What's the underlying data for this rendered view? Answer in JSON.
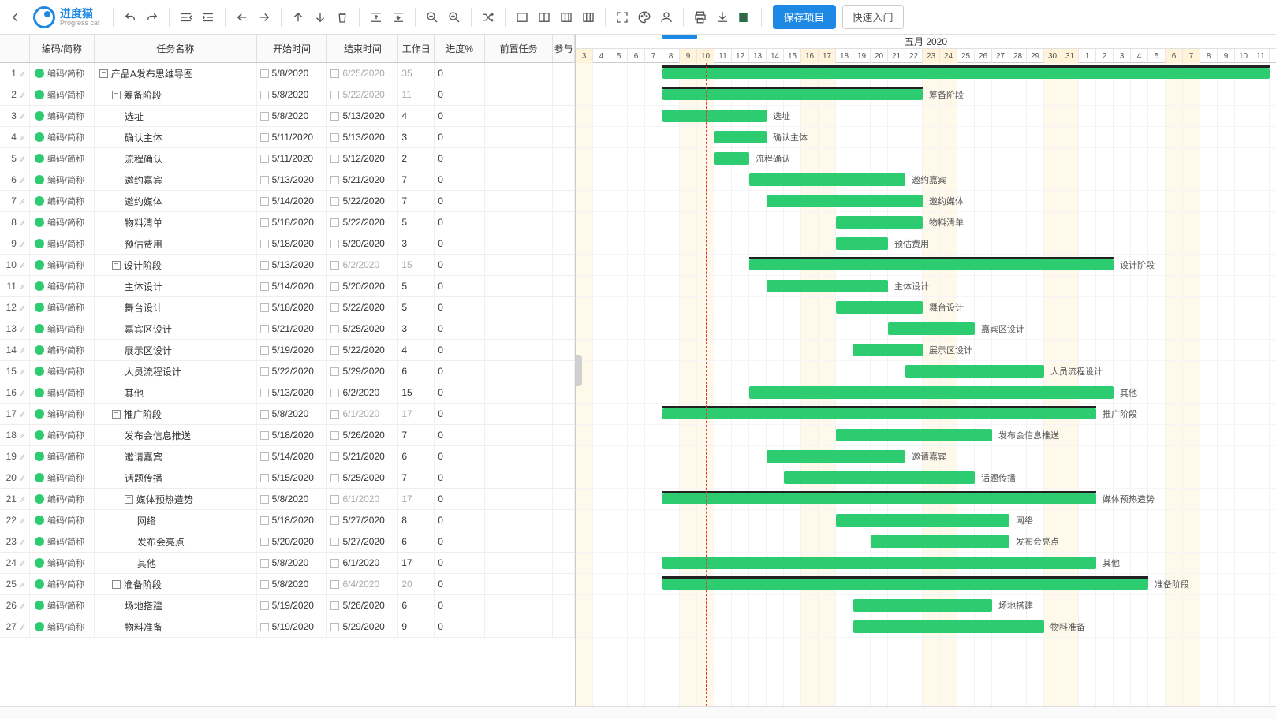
{
  "app": {
    "name": "进度猫",
    "sub": "Progress cat"
  },
  "toolbar": {
    "save": "保存项目",
    "quick": "快速入门"
  },
  "columns": {
    "idx": "",
    "code": "编码/简称",
    "name": "任务名称",
    "start": "开始时间",
    "end": "结束时间",
    "work": "工作日",
    "prog": "进度%",
    "pre": "前置任务",
    "part": "参与"
  },
  "timeline": {
    "month": "五月 2020",
    "days": [
      {
        "d": "3",
        "w": true
      },
      {
        "d": "4"
      },
      {
        "d": "5"
      },
      {
        "d": "6"
      },
      {
        "d": "7"
      },
      {
        "d": "8"
      },
      {
        "d": "9",
        "w": true
      },
      {
        "d": "10",
        "w": true
      },
      {
        "d": "11"
      },
      {
        "d": "12"
      },
      {
        "d": "13"
      },
      {
        "d": "14"
      },
      {
        "d": "15"
      },
      {
        "d": "16",
        "w": true
      },
      {
        "d": "17",
        "w": true
      },
      {
        "d": "18"
      },
      {
        "d": "19"
      },
      {
        "d": "20"
      },
      {
        "d": "21"
      },
      {
        "d": "22"
      },
      {
        "d": "23",
        "w": true
      },
      {
        "d": "24",
        "w": true
      },
      {
        "d": "25"
      },
      {
        "d": "26"
      },
      {
        "d": "27"
      },
      {
        "d": "28"
      },
      {
        "d": "29"
      },
      {
        "d": "30",
        "w": true
      },
      {
        "d": "31",
        "w": true
      },
      {
        "d": "1"
      },
      {
        "d": "2"
      },
      {
        "d": "3"
      },
      {
        "d": "4"
      },
      {
        "d": "5"
      },
      {
        "d": "6",
        "w": true
      },
      {
        "d": "7",
        "w": true
      },
      {
        "d": "8"
      },
      {
        "d": "9"
      },
      {
        "d": "10"
      },
      {
        "d": "11"
      }
    ],
    "todayIndex": 7,
    "markerStart": 5,
    "markerSpan": 2
  },
  "tasks": [
    {
      "id": 1,
      "code": "编码/简称",
      "name": "产品A发布思维导图",
      "indent": 0,
      "group": true,
      "start": "5/8/2020",
      "end": "6/25/2020",
      "endDim": true,
      "work": "35",
      "workDim": true,
      "prog": "0",
      "s": 5,
      "e": 40
    },
    {
      "id": 2,
      "code": "编码/简称",
      "name": "筹备阶段",
      "indent": 1,
      "group": true,
      "start": "5/8/2020",
      "end": "5/22/2020",
      "endDim": true,
      "work": "11",
      "workDim": true,
      "prog": "0",
      "s": 5,
      "e": 20,
      "label": "筹备阶段"
    },
    {
      "id": 3,
      "code": "编码/简称",
      "name": "选址",
      "indent": 2,
      "start": "5/8/2020",
      "end": "5/13/2020",
      "work": "4",
      "prog": "0",
      "s": 5,
      "e": 11,
      "label": "选址"
    },
    {
      "id": 4,
      "code": "编码/简称",
      "name": "确认主体",
      "indent": 2,
      "start": "5/11/2020",
      "end": "5/13/2020",
      "work": "3",
      "prog": "0",
      "s": 8,
      "e": 11,
      "label": "确认主体"
    },
    {
      "id": 5,
      "code": "编码/简称",
      "name": "流程确认",
      "indent": 2,
      "start": "5/11/2020",
      "end": "5/12/2020",
      "work": "2",
      "prog": "0",
      "s": 8,
      "e": 10,
      "label": "流程确认"
    },
    {
      "id": 6,
      "code": "编码/简称",
      "name": "邀约嘉宾",
      "indent": 2,
      "start": "5/13/2020",
      "end": "5/21/2020",
      "work": "7",
      "prog": "0",
      "s": 10,
      "e": 19,
      "label": "邀约嘉宾"
    },
    {
      "id": 7,
      "code": "编码/简称",
      "name": "邀约媒体",
      "indent": 2,
      "start": "5/14/2020",
      "end": "5/22/2020",
      "work": "7",
      "prog": "0",
      "s": 11,
      "e": 20,
      "label": "邀约媒体"
    },
    {
      "id": 8,
      "code": "编码/简称",
      "name": "物料清单",
      "indent": 2,
      "start": "5/18/2020",
      "end": "5/22/2020",
      "work": "5",
      "prog": "0",
      "s": 15,
      "e": 20,
      "label": "物料清单"
    },
    {
      "id": 9,
      "code": "编码/简称",
      "name": "预估费用",
      "indent": 2,
      "start": "5/18/2020",
      "end": "5/20/2020",
      "work": "3",
      "prog": "0",
      "s": 15,
      "e": 18,
      "label": "预估费用"
    },
    {
      "id": 10,
      "code": "编码/简称",
      "name": "设计阶段",
      "indent": 1,
      "group": true,
      "start": "5/13/2020",
      "end": "6/2/2020",
      "endDim": true,
      "work": "15",
      "workDim": true,
      "prog": "0",
      "s": 10,
      "e": 31,
      "label": "设计阶段"
    },
    {
      "id": 11,
      "code": "编码/简称",
      "name": "主体设计",
      "indent": 2,
      "start": "5/14/2020",
      "end": "5/20/2020",
      "work": "5",
      "prog": "0",
      "s": 11,
      "e": 18,
      "label": "主体设计"
    },
    {
      "id": 12,
      "code": "编码/简称",
      "name": "舞台设计",
      "indent": 2,
      "start": "5/18/2020",
      "end": "5/22/2020",
      "work": "5",
      "prog": "0",
      "s": 15,
      "e": 20,
      "label": "舞台设计"
    },
    {
      "id": 13,
      "code": "编码/简称",
      "name": "嘉宾区设计",
      "indent": 2,
      "start": "5/21/2020",
      "end": "5/25/2020",
      "work": "3",
      "prog": "0",
      "s": 18,
      "e": 23,
      "label": "嘉宾区设计"
    },
    {
      "id": 14,
      "code": "编码/简称",
      "name": "展示区设计",
      "indent": 2,
      "start": "5/19/2020",
      "end": "5/22/2020",
      "work": "4",
      "prog": "0",
      "s": 16,
      "e": 20,
      "label": "展示区设计"
    },
    {
      "id": 15,
      "code": "编码/简称",
      "name": "人员流程设计",
      "indent": 2,
      "start": "5/22/2020",
      "end": "5/29/2020",
      "work": "6",
      "prog": "0",
      "s": 19,
      "e": 27,
      "label": "人员流程设计"
    },
    {
      "id": 16,
      "code": "编码/简称",
      "name": "其他",
      "indent": 2,
      "start": "5/13/2020",
      "end": "6/2/2020",
      "work": "15",
      "prog": "0",
      "s": 10,
      "e": 31,
      "label": "其他"
    },
    {
      "id": 17,
      "code": "编码/简称",
      "name": "推广阶段",
      "indent": 1,
      "group": true,
      "start": "5/8/2020",
      "end": "6/1/2020",
      "endDim": true,
      "work": "17",
      "workDim": true,
      "prog": "0",
      "s": 5,
      "e": 30,
      "label": "推广阶段"
    },
    {
      "id": 18,
      "code": "编码/简称",
      "name": "发布会信息推送",
      "indent": 2,
      "start": "5/18/2020",
      "end": "5/26/2020",
      "work": "7",
      "prog": "0",
      "s": 15,
      "e": 24,
      "label": "发布会信息推送"
    },
    {
      "id": 19,
      "code": "编码/简称",
      "name": "邀请嘉宾",
      "indent": 2,
      "start": "5/14/2020",
      "end": "5/21/2020",
      "work": "6",
      "prog": "0",
      "s": 11,
      "e": 19,
      "label": "邀请嘉宾"
    },
    {
      "id": 20,
      "code": "编码/简称",
      "name": "话题传播",
      "indent": 2,
      "start": "5/15/2020",
      "end": "5/25/2020",
      "work": "7",
      "prog": "0",
      "s": 12,
      "e": 23,
      "label": "话题传播"
    },
    {
      "id": 21,
      "code": "编码/简称",
      "name": "媒体预热造势",
      "indent": 2,
      "group": true,
      "start": "5/8/2020",
      "end": "6/1/2020",
      "endDim": true,
      "work": "17",
      "workDim": true,
      "prog": "0",
      "s": 5,
      "e": 30,
      "label": "媒体预热造势"
    },
    {
      "id": 22,
      "code": "编码/简称",
      "name": "网络",
      "indent": 3,
      "start": "5/18/2020",
      "end": "5/27/2020",
      "work": "8",
      "prog": "0",
      "s": 15,
      "e": 25,
      "label": "网络"
    },
    {
      "id": 23,
      "code": "编码/简称",
      "name": "发布会亮点",
      "indent": 3,
      "start": "5/20/2020",
      "end": "5/27/2020",
      "work": "6",
      "prog": "0",
      "s": 17,
      "e": 25,
      "label": "发布会亮点"
    },
    {
      "id": 24,
      "code": "编码/简称",
      "name": "其他",
      "indent": 3,
      "start": "5/8/2020",
      "end": "6/1/2020",
      "work": "17",
      "prog": "0",
      "s": 5,
      "e": 30,
      "label": "其他"
    },
    {
      "id": 25,
      "code": "编码/简称",
      "name": "准备阶段",
      "indent": 1,
      "group": true,
      "start": "5/8/2020",
      "end": "6/4/2020",
      "endDim": true,
      "work": "20",
      "workDim": true,
      "prog": "0",
      "s": 5,
      "e": 33,
      "label": "准备阶段"
    },
    {
      "id": 26,
      "code": "编码/简称",
      "name": "场地搭建",
      "indent": 2,
      "start": "5/19/2020",
      "end": "5/26/2020",
      "work": "6",
      "prog": "0",
      "s": 16,
      "e": 24,
      "label": "场地搭建"
    },
    {
      "id": 27,
      "code": "编码/简称",
      "name": "物料准备",
      "indent": 2,
      "start": "5/19/2020",
      "end": "5/29/2020",
      "work": "9",
      "prog": "0",
      "s": 16,
      "e": 27,
      "label": "物料准备"
    }
  ]
}
